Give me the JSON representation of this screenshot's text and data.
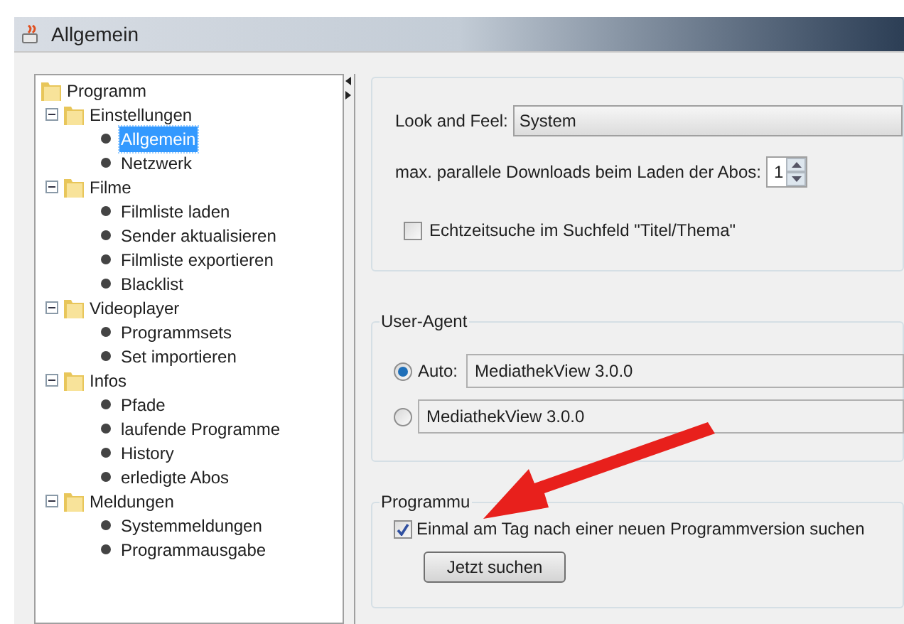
{
  "window": {
    "title": "Allgemein"
  },
  "tree": {
    "label": "Programm",
    "children": [
      {
        "label": "Einstellungen",
        "expanded": true,
        "children": [
          {
            "label": "Allgemein",
            "selected": true
          },
          {
            "label": "Netzwerk",
            "selected": false
          }
        ]
      },
      {
        "label": "Filme",
        "expanded": true,
        "children": [
          {
            "label": "Filmliste laden",
            "selected": false
          },
          {
            "label": "Sender aktualisieren",
            "selected": false
          },
          {
            "label": "Filmliste exportieren",
            "selected": false
          },
          {
            "label": "Blacklist",
            "selected": false
          }
        ]
      },
      {
        "label": "Videoplayer",
        "expanded": true,
        "children": [
          {
            "label": "Programmsets",
            "selected": false
          },
          {
            "label": "Set importieren",
            "selected": false
          }
        ]
      },
      {
        "label": "Infos",
        "expanded": true,
        "children": [
          {
            "label": "Pfade",
            "selected": false
          },
          {
            "label": "laufende Programme",
            "selected": false
          },
          {
            "label": "History",
            "selected": false
          },
          {
            "label": "erledigte Abos",
            "selected": false
          }
        ]
      },
      {
        "label": "Meldungen",
        "expanded": true,
        "children": [
          {
            "label": "Systemmeldungen",
            "selected": false
          },
          {
            "label": "Programmausgabe",
            "selected": false
          }
        ]
      }
    ]
  },
  "general": {
    "look_and_feel": {
      "label": "Look and Feel:",
      "value": "System"
    },
    "parallel_downloads": {
      "label": "max. parallele Downloads beim Laden der Abos:",
      "value": "1"
    },
    "realtime_search": {
      "label": "Echtzeitsuche im Suchfeld \"Titel/Thema\"",
      "checked": false
    }
  },
  "user_agent": {
    "title": "User-Agent",
    "options": [
      {
        "label": "Auto:",
        "value": "MediathekView 3.0.0",
        "selected": true
      },
      {
        "value": "MediathekView 3.0.0",
        "selected": false
      }
    ]
  },
  "program_update": {
    "title": "Programmu",
    "daily_check": {
      "label": "Einmal am Tag nach einer neuen Programmversion suchen",
      "checked": true
    },
    "button": "Jetzt suchen"
  }
}
